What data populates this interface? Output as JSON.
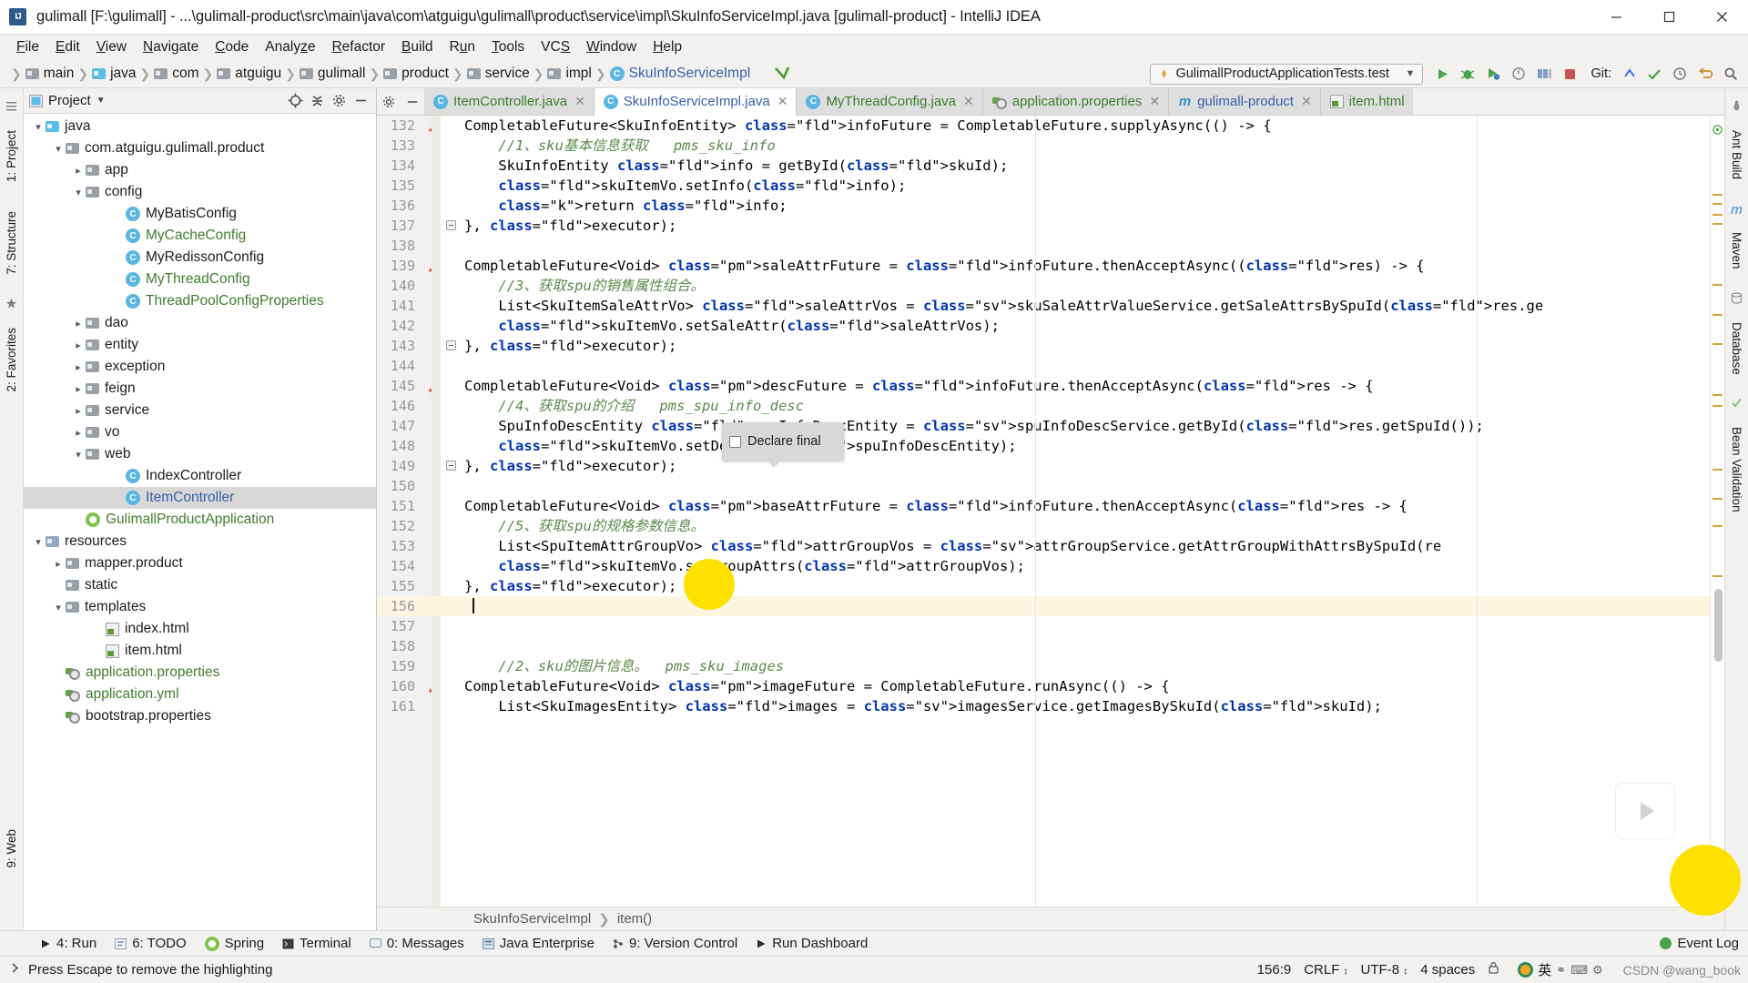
{
  "window": {
    "title": "gulimall [F:\\gulimall] - ...\\gulimall-product\\src\\main\\java\\com\\atguigu\\gulimall\\product\\service\\impl\\SkuInfoServiceImpl.java [gulimall-product] - IntelliJ IDEA",
    "minimize_label": "Minimize",
    "maximize_label": "Maximize",
    "close_label": "Close"
  },
  "menubar": {
    "items": [
      {
        "label": "File"
      },
      {
        "label": "Edit"
      },
      {
        "label": "View"
      },
      {
        "label": "Navigate"
      },
      {
        "label": "Code"
      },
      {
        "label": "Analyze"
      },
      {
        "label": "Refactor"
      },
      {
        "label": "Build"
      },
      {
        "label": "Run"
      },
      {
        "label": "Tools"
      },
      {
        "label": "VCS"
      },
      {
        "label": "Window"
      },
      {
        "label": "Help"
      }
    ]
  },
  "navbar": {
    "breadcrumbs": [
      {
        "label": "main",
        "type": "folder"
      },
      {
        "label": "java",
        "type": "folder-blue"
      },
      {
        "label": "com",
        "type": "folder"
      },
      {
        "label": "atguigu",
        "type": "folder"
      },
      {
        "label": "gulimall",
        "type": "folder"
      },
      {
        "label": "product",
        "type": "folder"
      },
      {
        "label": "service",
        "type": "folder"
      },
      {
        "label": "impl",
        "type": "folder"
      },
      {
        "label": "SkuInfoServiceImpl",
        "type": "class"
      }
    ],
    "run_config": "GulimallProductApplicationTests.test",
    "git_label": "Git:",
    "icons": [
      "run-icon",
      "debug-icon",
      "run-coverage-icon",
      "profile-icon",
      "build-icon",
      "stop-icon",
      "git-update-icon",
      "git-commit-icon",
      "git-history-icon",
      "git-rollback-icon",
      "search-everywhere-icon"
    ]
  },
  "sidebar_rail_left": {
    "tabs": [
      "1: Project",
      "7: Structure",
      "2: Favorites"
    ],
    "bottom_tab": "9: Web"
  },
  "sidebar_rail_right": {
    "tabs": [
      "Ant Build",
      "Maven",
      "Database",
      "Bean Validation"
    ]
  },
  "project_panel": {
    "title": "Project",
    "tree": [
      {
        "indent": 2,
        "arrow": "down",
        "icon": "folder-blue",
        "label": "java",
        "color": "default"
      },
      {
        "indent": 3,
        "arrow": "down",
        "icon": "folder-pkg",
        "label": "com.atguigu.gulimall.product",
        "color": "default"
      },
      {
        "indent": 4,
        "arrow": "right",
        "icon": "folder-pkg",
        "label": "app",
        "color": "default"
      },
      {
        "indent": 4,
        "arrow": "down",
        "icon": "folder-pkg",
        "label": "config",
        "color": "default"
      },
      {
        "indent": 6,
        "arrow": "none",
        "icon": "class",
        "label": "MyBatisConfig",
        "color": "default"
      },
      {
        "indent": 6,
        "arrow": "none",
        "icon": "class",
        "label": "MyCacheConfig",
        "color": "green"
      },
      {
        "indent": 6,
        "arrow": "none",
        "icon": "class",
        "label": "MyRedissonConfig",
        "color": "default"
      },
      {
        "indent": 6,
        "arrow": "none",
        "icon": "class",
        "label": "MyThreadConfig",
        "color": "green"
      },
      {
        "indent": 6,
        "arrow": "none",
        "icon": "class",
        "label": "ThreadPoolConfigProperties",
        "color": "green"
      },
      {
        "indent": 4,
        "arrow": "right",
        "icon": "folder-pkg",
        "label": "dao",
        "color": "default"
      },
      {
        "indent": 4,
        "arrow": "right",
        "icon": "folder-pkg",
        "label": "entity",
        "color": "default"
      },
      {
        "indent": 4,
        "arrow": "right",
        "icon": "folder-pkg",
        "label": "exception",
        "color": "default"
      },
      {
        "indent": 4,
        "arrow": "right",
        "icon": "folder-pkg",
        "label": "feign",
        "color": "default"
      },
      {
        "indent": 4,
        "arrow": "right",
        "icon": "folder-pkg",
        "label": "service",
        "color": "default"
      },
      {
        "indent": 4,
        "arrow": "right",
        "icon": "folder-pkg",
        "label": "vo",
        "color": "default"
      },
      {
        "indent": 4,
        "arrow": "down",
        "icon": "folder-pkg",
        "label": "web",
        "color": "default"
      },
      {
        "indent": 6,
        "arrow": "none",
        "icon": "class",
        "label": "IndexController",
        "color": "default"
      },
      {
        "indent": 6,
        "arrow": "none",
        "icon": "class",
        "label": "ItemController",
        "color": "blue",
        "selected": true
      },
      {
        "indent": 4,
        "arrow": "none",
        "icon": "spring",
        "label": "GulimallProductApplication",
        "color": "green"
      },
      {
        "indent": 2,
        "arrow": "down",
        "icon": "folder-res",
        "label": "resources",
        "color": "default"
      },
      {
        "indent": 3,
        "arrow": "right",
        "icon": "folder-pkg",
        "label": "mapper.product",
        "color": "default"
      },
      {
        "indent": 3,
        "arrow": "none",
        "icon": "folder-pkg",
        "label": "static",
        "color": "default"
      },
      {
        "indent": 3,
        "arrow": "down",
        "icon": "folder-pkg",
        "label": "templates",
        "color": "default"
      },
      {
        "indent": 5,
        "arrow": "none",
        "icon": "html",
        "label": "index.html",
        "color": "default"
      },
      {
        "indent": 5,
        "arrow": "none",
        "icon": "html",
        "label": "item.html",
        "color": "default"
      },
      {
        "indent": 3,
        "arrow": "none",
        "icon": "props",
        "label": "application.properties",
        "color": "green"
      },
      {
        "indent": 3,
        "arrow": "none",
        "icon": "props",
        "label": "application.yml",
        "color": "green"
      },
      {
        "indent": 3,
        "arrow": "none",
        "icon": "props",
        "label": "bootstrap.properties",
        "color": "default"
      }
    ]
  },
  "editor": {
    "tabs": [
      {
        "label": "ItemController.java",
        "icon": "class",
        "color": "green",
        "active": false,
        "closable": true
      },
      {
        "label": "SkuInfoServiceImpl.java",
        "icon": "class",
        "color": "blue",
        "active": true,
        "closable": true
      },
      {
        "label": "MyThreadConfig.java",
        "icon": "class",
        "color": "green",
        "active": false,
        "closable": true
      },
      {
        "label": "application.properties",
        "icon": "props",
        "color": "green",
        "active": false,
        "closable": true
      },
      {
        "label": "gulimall-product",
        "icon": "maven",
        "color": "blue",
        "active": false,
        "closable": true
      },
      {
        "label": "item.html",
        "icon": "html",
        "color": "green",
        "active": false,
        "closable": false
      }
    ],
    "breadcrumb": {
      "class": "SkuInfoServiceImpl",
      "method": "item()"
    },
    "hint_tooltip": {
      "label": "Declare final",
      "checked": false
    },
    "lines": [
      {
        "num": 132,
        "warn": true,
        "fold": false,
        "text": "CompletableFuture<SkuInfoEntity> infoFuture = CompletableFuture.supplyAsync(() -> {"
      },
      {
        "num": 133,
        "warn": false,
        "fold": false,
        "text": "    //1、sku基本信息获取   pms_sku_info"
      },
      {
        "num": 134,
        "warn": false,
        "fold": false,
        "text": "    SkuInfoEntity info = getById(skuId);"
      },
      {
        "num": 135,
        "warn": false,
        "fold": false,
        "text": "    skuItemVo.setInfo(info);"
      },
      {
        "num": 136,
        "warn": false,
        "fold": false,
        "text": "    return info;"
      },
      {
        "num": 137,
        "warn": false,
        "fold": true,
        "text": "}, executor);"
      },
      {
        "num": 138,
        "warn": false,
        "fold": false,
        "text": ""
      },
      {
        "num": 139,
        "warn": true,
        "fold": false,
        "text": "CompletableFuture<Void> saleAttrFuture = infoFuture.thenAcceptAsync((res) -> {"
      },
      {
        "num": 140,
        "warn": false,
        "fold": false,
        "text": "    //3、获取spu的销售属性组合。"
      },
      {
        "num": 141,
        "warn": false,
        "fold": false,
        "text": "    List<SkuItemSaleAttrVo> saleAttrVos = skuSaleAttrValueService.getSaleAttrsBySpuId(res.ge"
      },
      {
        "num": 142,
        "warn": false,
        "fold": false,
        "text": "    skuItemVo.setSaleAttr(saleAttrVos);"
      },
      {
        "num": 143,
        "warn": false,
        "fold": true,
        "text": "}, executor);"
      },
      {
        "num": 144,
        "warn": false,
        "fold": false,
        "text": ""
      },
      {
        "num": 145,
        "warn": true,
        "fold": false,
        "text": "CompletableFuture<Void> descFuture = infoFuture.thenAcceptAsync(res -> {"
      },
      {
        "num": 146,
        "warn": false,
        "fold": false,
        "text": "    //4、获取spu的介绍   pms_spu_info_desc"
      },
      {
        "num": 147,
        "warn": false,
        "fold": false,
        "text": "    SpuInfoDescEntity spuInfoDescEntity = spuInfoDescService.getById(res.getSpuId());"
      },
      {
        "num": 148,
        "warn": false,
        "fold": false,
        "text": "    skuItemVo.setDesc(spuInfoDescEntity);"
      },
      {
        "num": 149,
        "warn": false,
        "fold": true,
        "text": "}, executor);"
      },
      {
        "num": 150,
        "warn": false,
        "fold": false,
        "text": ""
      },
      {
        "num": 151,
        "warn": false,
        "fold": false,
        "text": "CompletableFuture<Void> baseAttrFuture = infoFuture.thenAcceptAsync(res -> {"
      },
      {
        "num": 152,
        "warn": false,
        "fold": false,
        "text": "    //5、获取spu的规格参数信息。"
      },
      {
        "num": 153,
        "warn": false,
        "fold": false,
        "text": "    List<SpuItemAttrGroupVo> attrGroupVos = attrGroupService.getAttrGroupWithAttrsBySpuId(re"
      },
      {
        "num": 154,
        "warn": false,
        "fold": false,
        "text": "    skuItemVo.setGroupAttrs(attrGroupVos);"
      },
      {
        "num": 155,
        "warn": false,
        "fold": false,
        "text": "}, executor);"
      },
      {
        "num": 156,
        "warn": false,
        "fold": false,
        "text": "",
        "highlight": true,
        "caret": true
      },
      {
        "num": 157,
        "warn": false,
        "fold": false,
        "text": ""
      },
      {
        "num": 158,
        "warn": false,
        "fold": false,
        "text": ""
      },
      {
        "num": 159,
        "warn": false,
        "fold": false,
        "text": "    //2、sku的图片信息。  pms_sku_images"
      },
      {
        "num": 160,
        "warn": true,
        "fold": false,
        "text": "CompletableFuture<Void> imageFuture = CompletableFuture.runAsync(() -> {"
      },
      {
        "num": 161,
        "warn": false,
        "fold": false,
        "text": "    List<SkuImagesEntity> images = imagesService.getImagesBySkuId(skuId);"
      }
    ]
  },
  "bottombar": {
    "items": [
      {
        "label": "4: Run",
        "icon": "run-icon"
      },
      {
        "label": "6: TODO",
        "icon": "todo-icon"
      },
      {
        "label": "Spring",
        "icon": "spring-icon"
      },
      {
        "label": "Terminal",
        "icon": "terminal-icon"
      },
      {
        "label": "0: Messages",
        "icon": "messages-icon"
      },
      {
        "label": "Java Enterprise",
        "icon": "java-ee-icon"
      },
      {
        "label": "9: Version Control",
        "icon": "vcs-icon"
      },
      {
        "label": "Run Dashboard",
        "icon": "dashboard-icon"
      }
    ],
    "event_log": "Event Log"
  },
  "statusbar": {
    "message": "Press Escape to remove the highlighting",
    "caret_position": "156:9",
    "line_separator": "CRLF",
    "encoding": "UTF-8",
    "indent": "4 spaces",
    "ime": "英",
    "watermark": "CSDN @wang_book"
  },
  "colors": {
    "accent_blue": "#3b5fa8",
    "green": "#3f7d2e",
    "highlight_yellow": "#fcf6e0",
    "cursor_yellow": "#ffe100",
    "selection_gray": "#d8d8d8"
  }
}
